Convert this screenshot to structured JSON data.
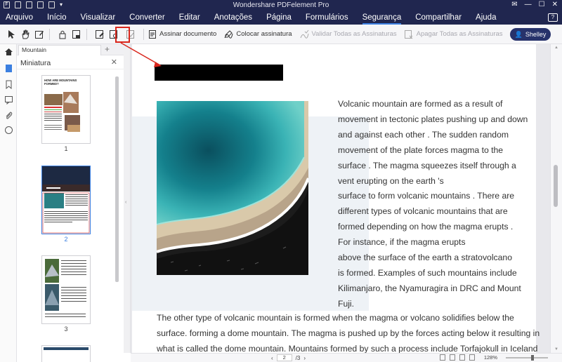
{
  "app": {
    "title": "Wondershare PDFelement Pro"
  },
  "menu": [
    "Arquivo",
    "Início",
    "Visualizar",
    "Converter",
    "Editar",
    "Anotações",
    "Página",
    "Formulários",
    "Segurança",
    "Compartilhar",
    "Ajuda"
  ],
  "active_menu": "Segurança",
  "toolbar": {
    "sign_document": "Assinar documento",
    "place_signature": "Colocar assinatura",
    "validate_all": "Validar Todas as Assinaturas",
    "delete_all": "Apagar Todas as Assinaturas"
  },
  "user": {
    "name": "Shelley"
  },
  "tab": {
    "name": "Mountain"
  },
  "panel": {
    "title": "Miniatura"
  },
  "thumbnails": [
    {
      "page": "1",
      "selected": false
    },
    {
      "page": "2",
      "selected": true
    },
    {
      "page": "3",
      "selected": false
    }
  ],
  "thumb1": {
    "heading": "HOW ARE MOUNTAINS FORMED?"
  },
  "document": {
    "right_lines": [
      "Volcanic mountain are formed as a result of",
      "movement in tectonic plates pushing up and down",
      "and against  each other . The sudden  random",
      "movement   of the plate forces  magma  to the",
      "surface . The magma squeezes  itself through  a",
      "vent erupting on the earth 's",
      "surface  to form volcanic mountains . There are",
      "different  types  of  volcanic  mountains  that  are",
      "formed depending  on how the magma erupts .",
      "For instance, if the magma erupts",
      "above the surface of the earth a stratovolcano",
      "is formed. Examples of such mountains include",
      "Kilimanjaro, the Nyamuragira in DRC and Mount",
      "Fuji."
    ],
    "bottom_lines": [
      "The other type of volcanic mountain is formed when the magma or volcano solidifies below the",
      "surface. forming a dome mountain. The magma is pushed up by the forces acting below it resulting in",
      "what is called the dome mountain. Mountains formed by such a process include Torfajokull in Iceland"
    ]
  },
  "status": {
    "page": "2",
    "total": "/3",
    "zoom": "128%"
  },
  "colors": {
    "titlebar": "#20264f",
    "accent": "#3b7fe0",
    "highlight": "#d9261c",
    "user_button": "#27326b"
  }
}
